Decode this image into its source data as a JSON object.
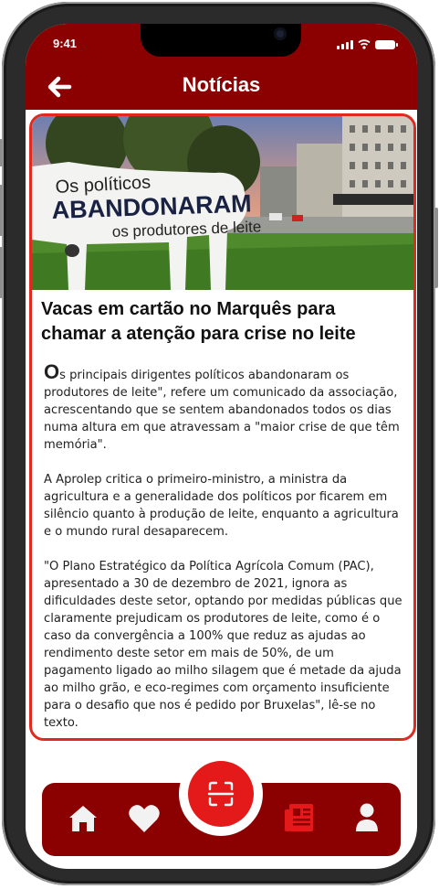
{
  "status_bar": {
    "time": "9:41"
  },
  "header": {
    "title": "Notícias",
    "back_icon": "arrow-left-icon"
  },
  "article": {
    "image_text": {
      "line1": "Os políticos",
      "line2": "ABANDONARAM",
      "line3": "os produtores de leite"
    },
    "headline": "Vacas em cartão no Marquês para chamar a atenção para crise no leite",
    "dropcap": "O",
    "paragraph1_rest": "s principais dirigentes políticos abandonaram os produtores de leite\", refere um comunicado da associação, acrescentando que se sentem abandonados todos os dias numa altura em que atravessam a \"maior crise de que têm memória\".",
    "paragraph2": "A Aprolep critica o primeiro-ministro, a ministra da agricultura e a generalidade dos políticos por ficarem em silêncio quanto à produção de leite, enquanto a agricultura e o mundo rural desaparecem.",
    "paragraph3": "\"O Plano Estratégico da Política Agrícola Comum (PAC), apresentado a 30 de dezembro de 2021, ignora as dificuldades deste setor, optando por medidas públicas que claramente prejudicam os produtores de leite, como é o caso da convergência a 100% que reduz as ajudas ao rendimento deste setor em mais de 50%, de um pagamento ligado ao milho silagem que é metade da ajuda ao milho grão, e eco-regimes com orçamento insuficiente para o desafio que nos é pedido por Bruxelas\", lê-se no texto."
  },
  "bottom_nav": {
    "items": [
      {
        "icon": "home-icon"
      },
      {
        "icon": "heart-icon"
      },
      {
        "icon": "scan-icon"
      },
      {
        "icon": "newspaper-icon",
        "active": true
      },
      {
        "icon": "user-icon"
      }
    ]
  },
  "colors": {
    "brand": "#8b0000",
    "accent": "#e41a1a",
    "card_border": "#e02a1f",
    "active_icon": "#e41a1a"
  }
}
